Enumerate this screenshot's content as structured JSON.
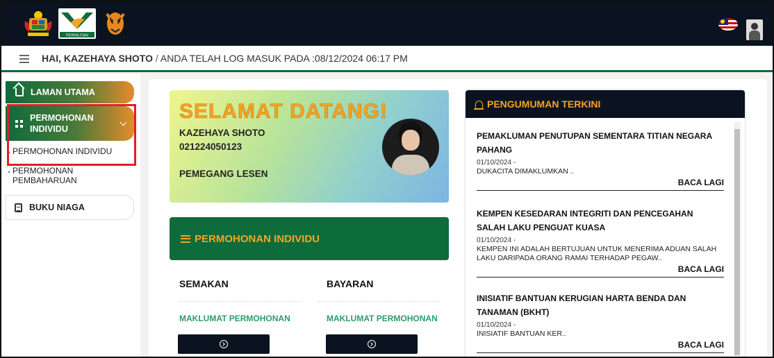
{
  "header": {
    "logos": [
      "malaysia-crest-logo",
      "perhilitan-logo",
      "tiger-logo"
    ],
    "perhilitan_text": "PERHILITAN"
  },
  "infobar": {
    "greeting": "HAI, KAZEHAYA SHOTO",
    "separator": " / ",
    "login_text": "ANDA TELAH LOG MASUK PADA :08/12/2024 06:17 PM"
  },
  "sidebar": {
    "home": "LAMAN UTAMA",
    "permohonan": "PERMOHONAN",
    "permohonan_line2": "INDIVIDU",
    "sub_individu": "PERMOHONAN INDIVIDU",
    "sub_baharu_line1": "PERMOHONAN",
    "sub_baharu_line2": "PEMBAHARUAN",
    "buku": "BUKU NIAGA"
  },
  "welcome": {
    "title": "SELAMAT DATANG!",
    "name": "KAZEHAYA SHOTO",
    "id": "021224050123",
    "role": "PEMEGANG LESEN"
  },
  "permohonan_section": {
    "banner": "PERMOHONAN INDIVIDU",
    "col1_head": "SEMAKAN",
    "col1_link": "MAKLUMAT PERMOHONAN",
    "col2_head": "BAYARAN",
    "col2_link": "MAKLUMAT PERMOHONAN"
  },
  "announcements": {
    "heading": "PENGUMUMAN TERKINI",
    "items": [
      {
        "title": "PEMAKLUMAN PENUTUPAN SEMENTARA TITIAN NEGARA PAHANG",
        "date": "01/10/2024 -",
        "body": "DUKACITA DIMAKLUMKAN ..",
        "more": "BACA LAGI"
      },
      {
        "title": "KEMPEN KESEDARAN INTEGRITI DAN PENCEGAHAN SALAH LAKU PENGUAT KUASA",
        "date": "01/10/2024 -",
        "body": "KEMPEN INI ADALAH BERTUJUAN UNTUK MENERIMA ADUAN SALAH LAKU DARIPADA ORANG RAMAI TERHADAP PEGAW..",
        "more": "BACA LAGI"
      },
      {
        "title": "INISIATIF BANTUAN KERUGIAN HARTA BENDA DAN TANAMAN (BKHT)",
        "date": "01/10/2024 -",
        "body": "INISIATIF BANTUAN KER..",
        "more": "BACA LAGI"
      }
    ]
  },
  "colors": {
    "brand_green": "#0e6b3b",
    "accent_orange": "#f4a524",
    "header_dark": "#0b1320",
    "highlight_red": "#e01e26"
  }
}
